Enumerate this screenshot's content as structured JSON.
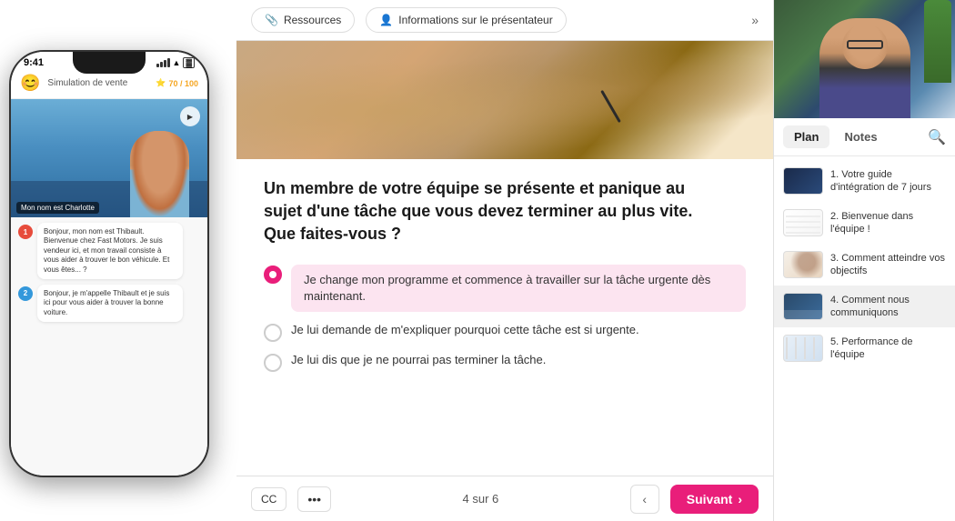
{
  "nav": {
    "resources_label": "Ressources",
    "presenter_info_label": "Informations sur le présentateur",
    "chevron_icon": "»"
  },
  "phone": {
    "time": "9:41",
    "simulation_title": "Simulation de vente",
    "score": "70 / 100",
    "charlotte_label": "Mon nom est Charlotte",
    "messages": [
      {
        "number": "1",
        "text": "Bonjour, mon nom est Thibault. Bienvenue chez Fast Motors. Je suis vendeur ici, et mon travail consiste à vous aider à trouver le bon véhicule. Et vous êtes... ?"
      },
      {
        "number": "2",
        "text": "Bonjour, je m'appelle Thibault et je suis ici pour vous aider à trouver la bonne voiture."
      }
    ]
  },
  "content": {
    "question": "Un membre de votre équipe se présente et panique au sujet d'une tâche que vous devez terminer au plus vite. Que faites-vous ?",
    "options": [
      {
        "id": 1,
        "text": "Je change mon programme et commence à travailler sur la tâche urgente dès maintenant.",
        "selected": true
      },
      {
        "id": 2,
        "text": "Je lui demande de m'expliquer pourquoi cette tâche est si urgente.",
        "selected": false
      },
      {
        "id": 3,
        "text": "Je lui dis que je ne pourrai pas terminer la tâche.",
        "selected": false
      }
    ],
    "pagination": "4 sur 6",
    "next_label": "Suivant",
    "cc_label": "CC"
  },
  "right_panel": {
    "tab_plan": "Plan",
    "tab_notes": "Notes",
    "slides": [
      {
        "id": 1,
        "label": "1. Votre guide d'intégration de 7 jours"
      },
      {
        "id": 2,
        "label": "2. Bienvenue dans l'équipe !"
      },
      {
        "id": 3,
        "label": "3. Comment atteindre vos objectifs"
      },
      {
        "id": 4,
        "label": "4. Comment nous communiquons",
        "active": true
      },
      {
        "id": 5,
        "label": "5. Performance de l'équipe"
      }
    ]
  }
}
